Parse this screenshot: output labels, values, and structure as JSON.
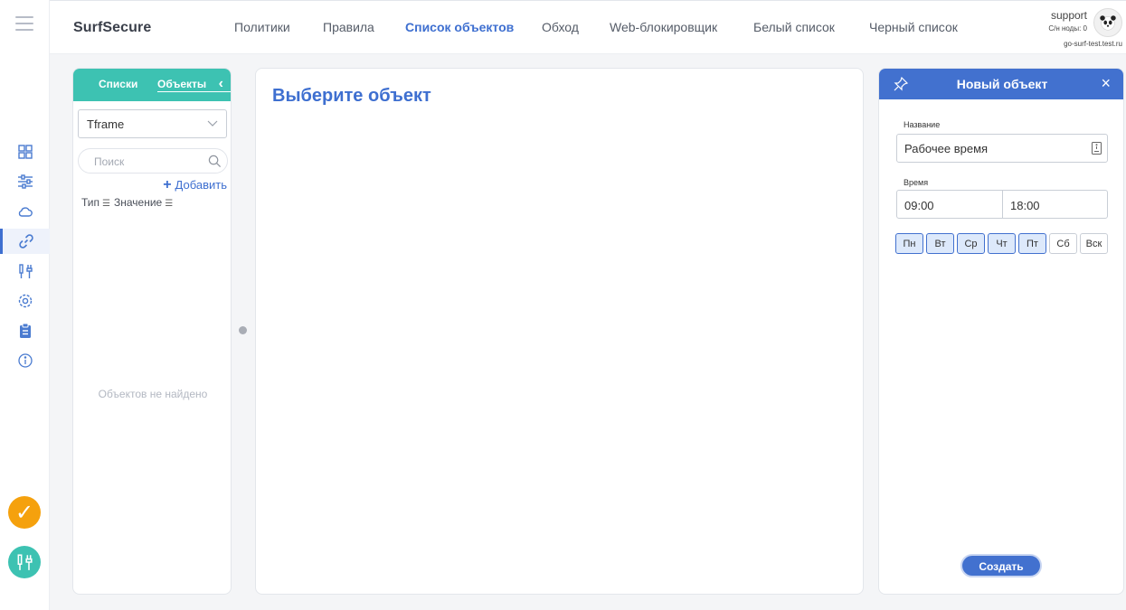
{
  "app": {
    "brand": "SurfSecure"
  },
  "nav": {
    "items": [
      "Политики",
      "Правила",
      "Список объектов",
      "Обход",
      "Web-блокировщик",
      "Белый список",
      "Черный список"
    ],
    "active_index": 2
  },
  "user": {
    "name": "support",
    "nodes": "С/н ноды: 0",
    "host": "go-surf-test.test.ru"
  },
  "sidebar": {
    "icons": [
      "dashboard-icon",
      "sliders-icon",
      "cloud-icon",
      "link-icon",
      "tools-icon",
      "gear-icon",
      "clipboard-icon",
      "info-icon"
    ],
    "active": "link-icon",
    "badges": [
      "check-icon",
      "tools-icon"
    ]
  },
  "lists_panel": {
    "tabs": [
      "Списки",
      "Объекты"
    ],
    "active_tab": "Объекты",
    "select_value": "Tframe",
    "search_placeholder": "Поиск",
    "add_label": "Добавить",
    "columns": [
      "Тип",
      "Значение"
    ],
    "empty_text": "Объектов не найдено"
  },
  "main": {
    "title": "Выберите объект"
  },
  "new_object": {
    "title": "Новый объект",
    "name_label": "Название",
    "name_value": "Рабочее время",
    "time_label": "Время",
    "time_from": "09:00",
    "time_to": "18:00",
    "days": [
      {
        "label": "Пн",
        "selected": true
      },
      {
        "label": "Вт",
        "selected": true
      },
      {
        "label": "Ср",
        "selected": true
      },
      {
        "label": "Чт",
        "selected": true
      },
      {
        "label": "Пт",
        "selected": true
      },
      {
        "label": "Сб",
        "selected": false
      },
      {
        "label": "Вск",
        "selected": false
      }
    ],
    "create_label": "Создать"
  },
  "colors": {
    "accent": "#3e6fd0",
    "teal": "#3dc2b2",
    "orange": "#f5a10d",
    "header_blue": "#4271cf"
  }
}
